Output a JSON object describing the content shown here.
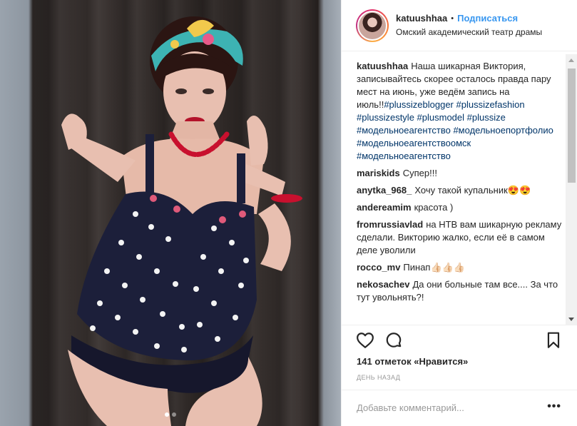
{
  "post": {
    "username": "katuushhaa",
    "separator": "•",
    "follow_label": "Подписаться",
    "location": "Омский академический театр драмы",
    "photo_alt": "",
    "carousel": {
      "total": 2,
      "active": 1
    }
  },
  "comments": [
    {
      "user": "katuushhaa",
      "text": "Наша шикарная Виктория, записывайтесь скорее осталось правда пару мест на июнь, уже ведём запись на июль!!",
      "tags": "#plussizeblogger #plussizefashion #plussizestyle #plusmodel #plussize #модельноеагентство #модельноепортфолио #модельноеагентствоомск #модельноеагентство"
    },
    {
      "user": "mariskids",
      "text": "Супер!!!"
    },
    {
      "user": "anytka_968_",
      "text": "Хочу такой купальник😍😍"
    },
    {
      "user": "andereamim",
      "text": "красота )"
    },
    {
      "user": "fromrussiavlad",
      "text": "на НТВ вам шикарную рекламу сделали. Викторию жалко, если её в самом деле уволили"
    },
    {
      "user": "rocco_mv",
      "text": "Пинап👍🏻👍🏻👍🏻"
    },
    {
      "user": "nekosachev",
      "text": "Да они больные там все.... За что тут увольнять?!"
    }
  ],
  "actions": {
    "like_icon": "heart-icon",
    "comment_icon": "speech-bubble-icon",
    "save_icon": "bookmark-icon"
  },
  "likes": {
    "count": "141",
    "label": "отметок «Нравится»"
  },
  "time_ago": "день назад",
  "add_comment": {
    "placeholder": "Добавьте комментарий...",
    "more_label": "•••"
  },
  "colors": {
    "link": "#3897f0",
    "hashtag": "#003569",
    "muted": "#999999",
    "text": "#262626"
  }
}
